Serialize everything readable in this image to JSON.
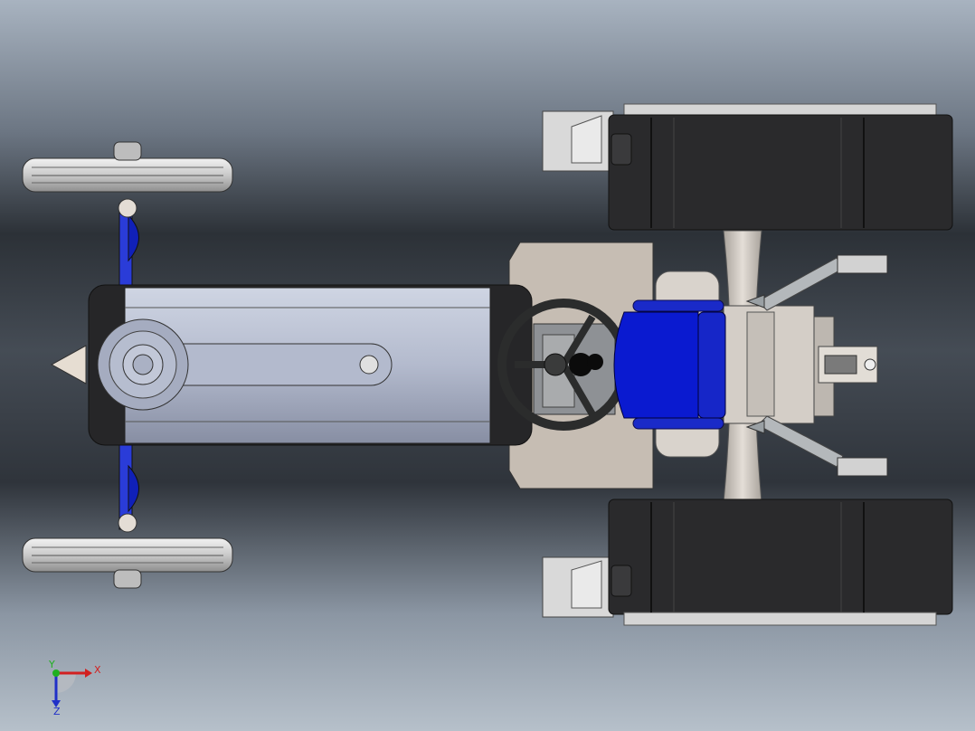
{
  "viewport": {
    "colors": {
      "hood": "#b7bfd2",
      "hood_shadow": "#8b93a8",
      "seat": "#0a1ad0",
      "tire": "#2a2a2c",
      "chassis": "#c6bdb3",
      "steel": "#c8cac9",
      "steering": "#2b2c2c"
    }
  },
  "triad": {
    "x_label": "X",
    "y_label": "Y",
    "z_label": "Z",
    "x_color": "#d22020",
    "y_color": "#20b020",
    "z_color": "#2030c8"
  }
}
